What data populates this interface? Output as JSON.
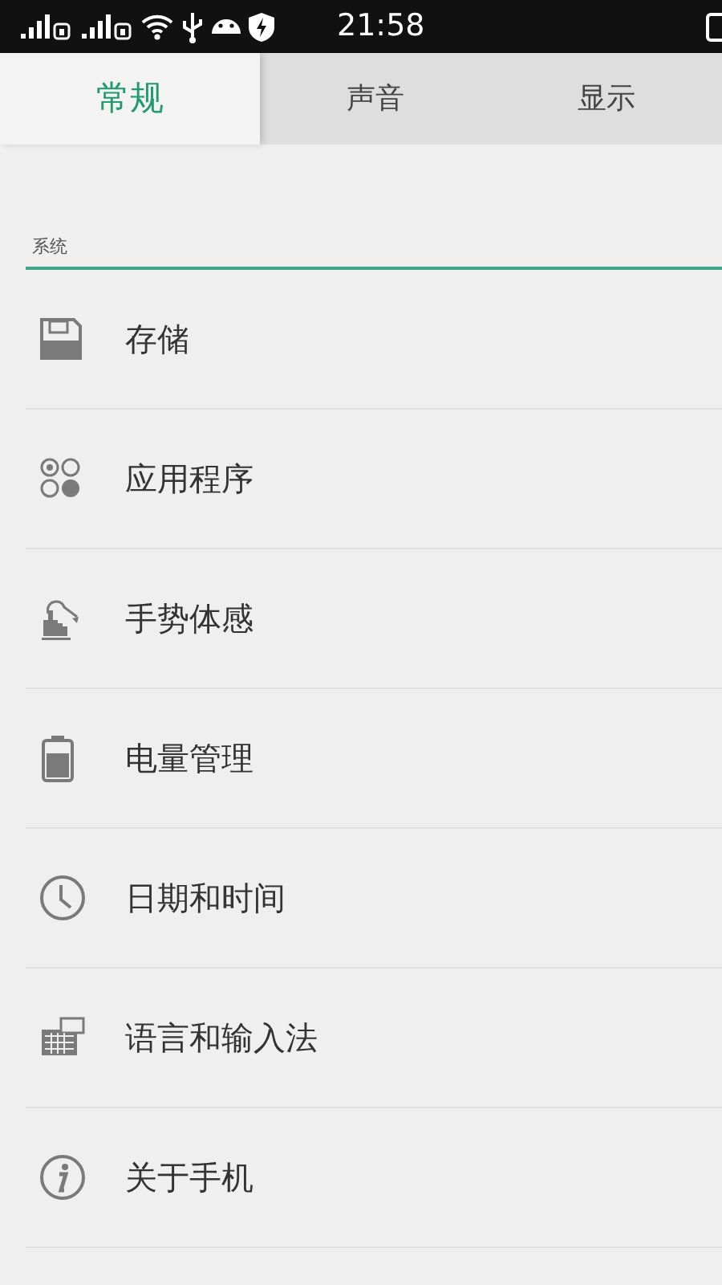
{
  "status_bar": {
    "time": "21:58"
  },
  "tabs": [
    {
      "label": "常规",
      "selected": true
    },
    {
      "label": "声音",
      "selected": false
    },
    {
      "label": "显示",
      "selected": false
    }
  ],
  "section": {
    "title": "系统"
  },
  "items": [
    {
      "label": "存储",
      "kind": "storage"
    },
    {
      "label": "应用程序",
      "kind": "apps"
    },
    {
      "label": "手势体感",
      "kind": "gesture"
    },
    {
      "label": "电量管理",
      "kind": "battery"
    },
    {
      "label": "日期和时间",
      "kind": "clock"
    },
    {
      "label": "语言和输入法",
      "kind": "keyboard"
    },
    {
      "label": "关于手机",
      "kind": "info"
    }
  ]
}
